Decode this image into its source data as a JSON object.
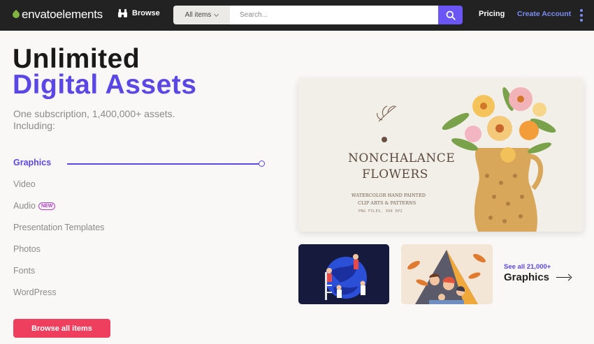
{
  "header": {
    "logo_part1": "envato",
    "logo_part2": "elements",
    "browse_label": "Browse",
    "category_select": "All items",
    "search_placeholder": "Search...",
    "pricing_label": "Pricing",
    "create_account_label": "Create Account"
  },
  "hero": {
    "title_line1": "Unlimited",
    "title_line2": "Digital Assets",
    "subtitle": "One subscription, 1,400,000+ assets. Including:",
    "categories": [
      {
        "label": "Graphics",
        "active": true
      },
      {
        "label": "Video"
      },
      {
        "label": "Audio",
        "badge": "NEW"
      },
      {
        "label": "Presentation Templates"
      },
      {
        "label": "Photos"
      },
      {
        "label": "Fonts"
      },
      {
        "label": "WordPress"
      }
    ],
    "cta_label": "Browse all items"
  },
  "feature": {
    "title_line1": "NONCHALANCE",
    "title_line2": "FLOWERS",
    "sub_line1": "WATERCOLOR HAND PAINTED",
    "sub_line2": "CLIP ARTS & PATTERNS",
    "sub_line3": "PNG FILES, 300 DPI"
  },
  "see_all": {
    "count_label": "See all 21,000+",
    "category_label": "Graphics"
  },
  "colors": {
    "accent": "#5a47e6",
    "cta": "#ee3f5f",
    "topbar": "#222222",
    "search_button": "#6c55f5",
    "logo_leaf": "#81b441"
  },
  "icons": {
    "browse": "binoculars-icon",
    "search": "search-icon",
    "more": "kebab-icon"
  }
}
